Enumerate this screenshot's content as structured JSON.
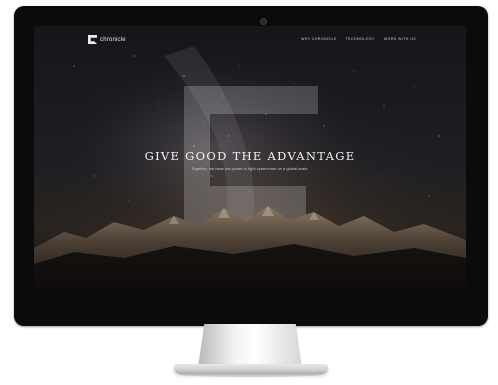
{
  "site": {
    "brand": "chronicle",
    "nav": [
      {
        "label": "WHY CHRONICLE"
      },
      {
        "label": "TECHNOLOGY"
      },
      {
        "label": "WORK WITH US"
      }
    ]
  },
  "hero": {
    "title": "GIVE GOOD THE ADVANTAGE",
    "subtitle": "Together, we have the power to fight cybercrime on a global scale."
  },
  "colors": {
    "bezel": "#0b0b0b",
    "screen_bg": "#141418",
    "hero_text": "#f3f3f3"
  },
  "icons": {
    "logo": "chronicle-logo-icon",
    "camera": "webcam-icon"
  }
}
